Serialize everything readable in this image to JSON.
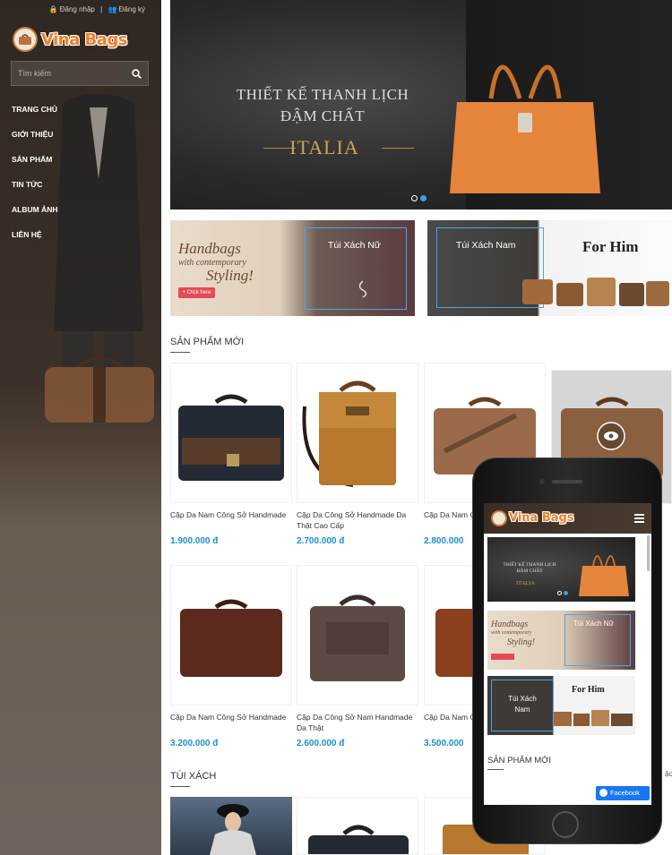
{
  "topbar": {
    "login": "Đăng nhập",
    "separator": "|",
    "register": "Đăng ký"
  },
  "logo": {
    "text": "Vina Bags"
  },
  "search": {
    "placeholder": "Tìm kiếm"
  },
  "nav": [
    "TRANG CHỦ",
    "GIỚI THIỆU",
    "SẢN PHẨM",
    "TIN TỨC",
    "ALBUM ẢNH",
    "LIÊN HỆ"
  ],
  "hero": {
    "line1": "THIẾT KẾ THANH LỊCH",
    "line2": "ĐẬM CHẤT",
    "brand": "ITALIA"
  },
  "banners": {
    "womens": {
      "script1": "Handbags",
      "script2": "with contemporary",
      "script3": "Styling!",
      "button": "+ Click here",
      "label": "Túi Xách Nữ"
    },
    "mens": {
      "label": "Túi Xách Nam",
      "tagline": "For Him"
    }
  },
  "sections": {
    "new_products": "SẢN PHẨM MỚI",
    "bags": "TÚI XÁCH"
  },
  "products_row1": [
    {
      "name": "Cặp Da Nam Công Sở Handmade",
      "price": "1.900.000 đ"
    },
    {
      "name": "Cặp Da Công Sở Handmade Da Thật Cao Cấp",
      "price": "2.700.000 đ"
    },
    {
      "name": "Cặp Da Nam C Handmade",
      "price": "2.800.000"
    }
  ],
  "products_row2": [
    {
      "name": "Cặp Da Nam Công Sở Handmade",
      "price": "3.200.000 đ"
    },
    {
      "name": "Cặp Da Công Sở Nam Handmade Da Thật",
      "price": "2.600.000 đ"
    },
    {
      "name": "Cặp Da Nam C Handmade",
      "price": "3.500.000"
    }
  ],
  "mobile": {
    "logo": "Vina Bags",
    "hero_line1": "THIẾT KẾ THANH LỊCH",
    "hero_line2": "ĐẬM CHẤT",
    "hero_brand": "ITALIA",
    "womens_label": "Túi Xách Nữ",
    "mens_label": "Túi Xách Nam",
    "for_him": "For Him",
    "section": "SẢN PHẨM MỚI",
    "facebook": "Facebook"
  },
  "colors": {
    "accent": "#1b8fd0",
    "logo": "#f07f2a",
    "frame": "#4aa6e6"
  }
}
